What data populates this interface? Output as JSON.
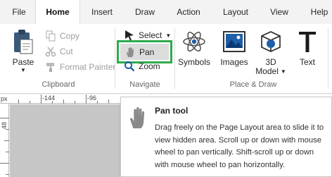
{
  "tabs": [
    {
      "label": "File",
      "active": false
    },
    {
      "label": "Home",
      "active": true
    },
    {
      "label": "Insert",
      "active": false
    },
    {
      "label": "Draw",
      "active": false
    },
    {
      "label": "Action",
      "active": false
    },
    {
      "label": "Layout",
      "active": false
    },
    {
      "label": "View",
      "active": false
    },
    {
      "label": "Help",
      "active": false
    }
  ],
  "clipboard": {
    "paste_label": "Paste",
    "copy_label": "Copy",
    "cut_label": "Cut",
    "format_painter_label": "Format Painter",
    "group_label": "Clipboard"
  },
  "navigate": {
    "select_label": "Select",
    "pan_label": "Pan",
    "zoom_label": "Zoom",
    "group_label": "Navigate"
  },
  "place_draw": {
    "symbols_label": "Symbols",
    "images_label": "Images",
    "model3d_label_line1": "3D",
    "model3d_label_line2": "Model",
    "text_label": "Text",
    "group_label": "Place & Draw"
  },
  "ruler": {
    "unit": "px",
    "top_ticks": [
      "-144",
      "-96"
    ],
    "left_ticks": [
      "48"
    ]
  },
  "tooltip": {
    "title": "Pan tool",
    "body": "Drag freely on the Page Layout area to slide it to view hidden area. Scroll up or down with mouse wheel to pan vertically. Shift-scroll up or down with mouse wheel to pan horizontally."
  },
  "colors": {
    "highlight": "#2eab4b",
    "accent_blue": "#1f5fa8",
    "canvas": "#c6c6c6"
  }
}
